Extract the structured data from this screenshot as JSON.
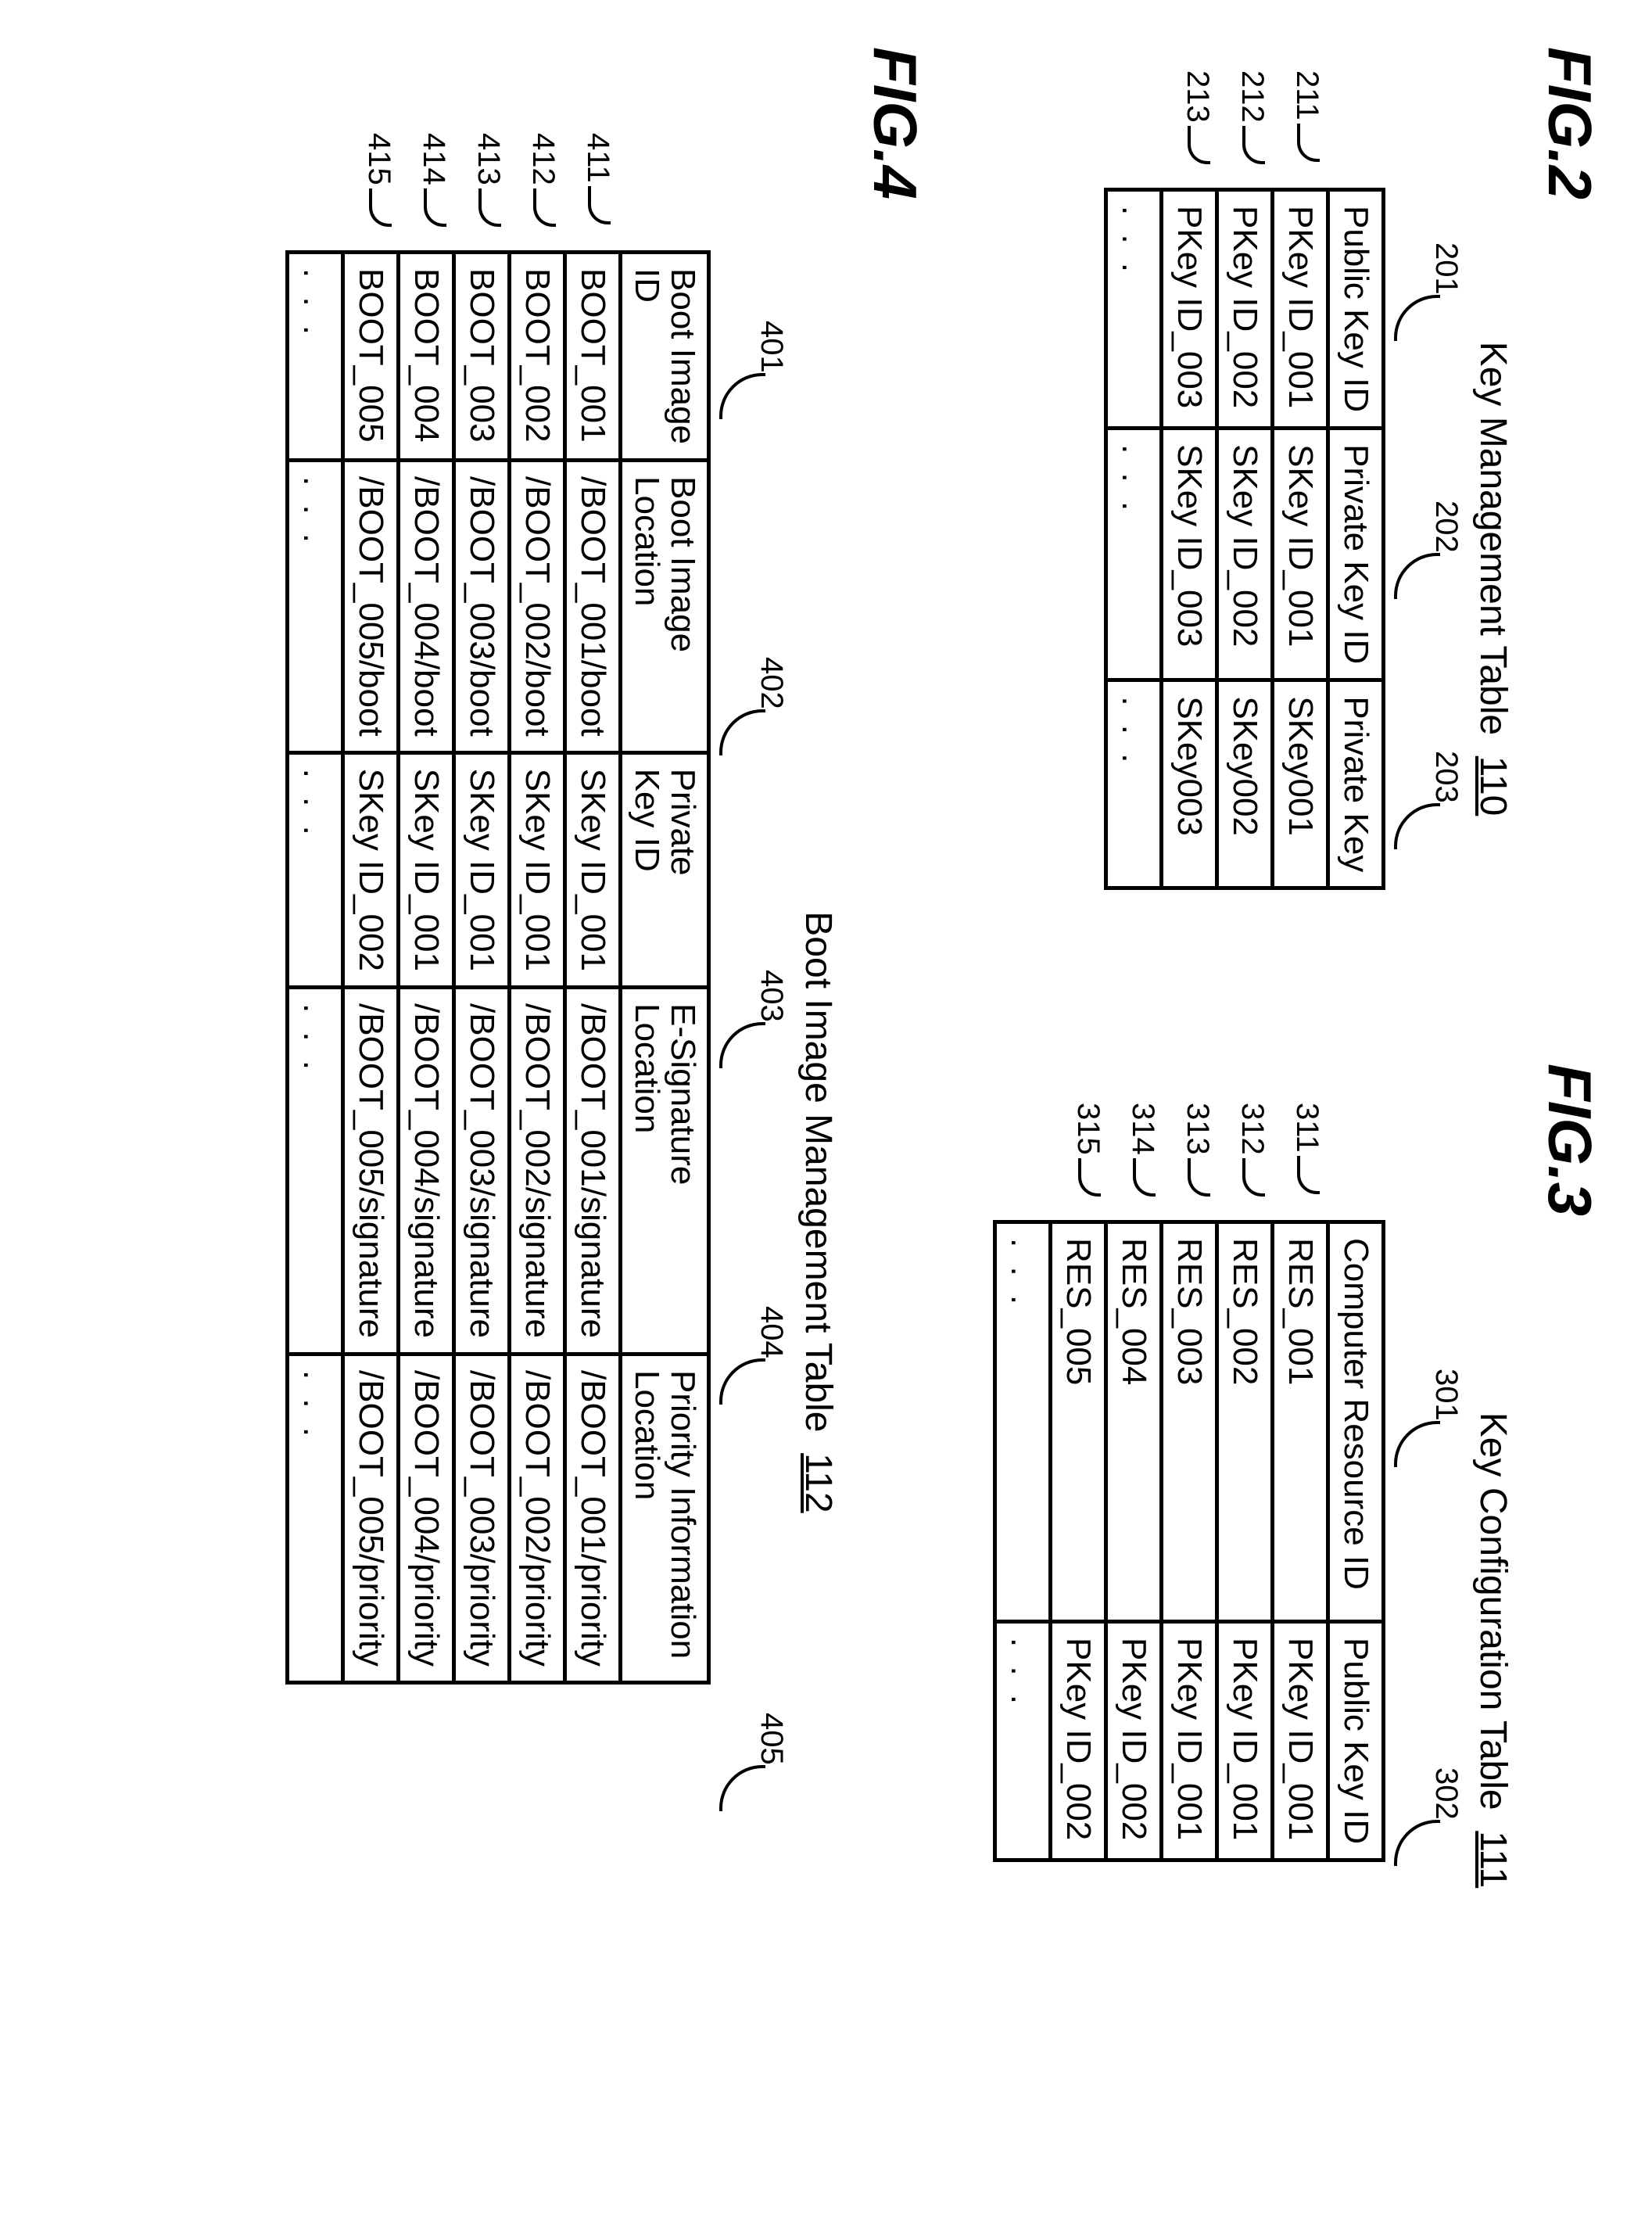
{
  "fig2": {
    "label": "FIG.2",
    "title_prefix": "Key Management Table",
    "title_ref": "110",
    "col_callouts": [
      "201",
      "202",
      "203"
    ],
    "row_callouts": [
      "211",
      "212",
      "213"
    ],
    "headers": [
      "Public Key ID",
      "Private Key ID",
      "Private Key"
    ],
    "rows": [
      [
        "PKey ID_001",
        "SKey ID_001",
        "SKey001"
      ],
      [
        "PKey ID_002",
        "SKey ID_002",
        "SKey002"
      ],
      [
        "PKey ID_003",
        "SKey ID_003",
        "SKey003"
      ]
    ],
    "dots": ". . ."
  },
  "fig3": {
    "label": "FIG.3",
    "title_prefix": "Key Configuration Table",
    "title_ref": "111",
    "col_callouts": [
      "301",
      "302"
    ],
    "row_callouts": [
      "311",
      "312",
      "313",
      "314",
      "315"
    ],
    "headers": [
      "Computer Resource ID",
      "Public Key ID"
    ],
    "rows": [
      [
        "RES_001",
        "PKey ID_001"
      ],
      [
        "RES_002",
        "PKey ID_001"
      ],
      [
        "RES_003",
        "PKey ID_001"
      ],
      [
        "RES_004",
        "PKey ID_002"
      ],
      [
        "RES_005",
        "PKey ID_002"
      ]
    ],
    "dots": ". . ."
  },
  "fig4": {
    "label": "FIG.4",
    "title_prefix": "Boot Image Management Table",
    "title_ref": "112",
    "col_callouts": [
      "401",
      "402",
      "403",
      "404",
      "405"
    ],
    "row_callouts": [
      "411",
      "412",
      "413",
      "414",
      "415"
    ],
    "headers": [
      [
        "Boot Image",
        "ID"
      ],
      [
        "Boot Image",
        "Location"
      ],
      [
        "Private",
        "Key ID"
      ],
      [
        "E-Signature",
        "Location"
      ],
      [
        "Priority Information",
        "Location"
      ]
    ],
    "rows": [
      [
        "BOOT_001",
        "/BOOT_001/boot",
        "SKey ID_001",
        "/BOOT_001/signature",
        "/BOOT_001/priority"
      ],
      [
        "BOOT_002",
        "/BOOT_002/boot",
        "SKey ID_001",
        "/BOOT_002/signature",
        "/BOOT_002/priority"
      ],
      [
        "BOOT_003",
        "/BOOT_003/boot",
        "SKey ID_001",
        "/BOOT_003/signature",
        "/BOOT_003/priority"
      ],
      [
        "BOOT_004",
        "/BOOT_004/boot",
        "SKey ID_001",
        "/BOOT_004/signature",
        "/BOOT_004/priority"
      ],
      [
        "BOOT_005",
        "/BOOT_005/boot",
        "SKey ID_002",
        "/BOOT_005/signature",
        "/BOOT_005/priority"
      ]
    ],
    "dots": ". . ."
  }
}
